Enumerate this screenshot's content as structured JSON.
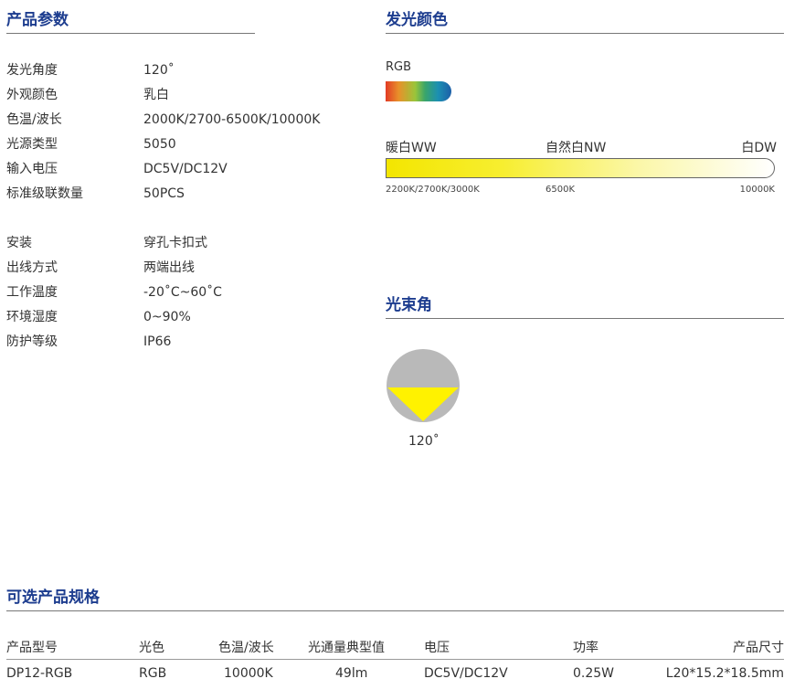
{
  "params": {
    "title": "产品参数",
    "group1": [
      {
        "k": "发光角度",
        "v": "120˚"
      },
      {
        "k": "外观颜色",
        "v": "乳白"
      },
      {
        "k": "色温/波长",
        "v": "2000K/2700-6500K/10000K"
      },
      {
        "k": "光源类型",
        "v": "5050"
      },
      {
        "k": "输入电压",
        "v": "DC5V/DC12V"
      },
      {
        "k": "标准级联数量",
        "v": "50PCS"
      }
    ],
    "group2": [
      {
        "k": "安装",
        "v": "穿孔卡扣式"
      },
      {
        "k": "出线方式",
        "v": "两端出线"
      },
      {
        "k": "工作温度",
        "v": "-20˚C~60˚C"
      },
      {
        "k": "环境湿度",
        "v": "0~90%"
      },
      {
        "k": "防护等级",
        "v": "IP66"
      }
    ]
  },
  "color": {
    "title": "发光颜色",
    "rgb_label": "RGB",
    "ww_label": "暖白WW",
    "nw_label": "自然白NW",
    "dw_label": "白DW",
    "ww_temp": "2200K/2700K/3000K",
    "nw_temp": "6500K",
    "dw_temp": "10000K"
  },
  "beam": {
    "title": "光束角",
    "angle_label": "120˚"
  },
  "specs": {
    "title": "可选产品规格",
    "headers": [
      "产品型号",
      "光色",
      "色温/波长",
      "光通量典型值",
      "电压",
      "功率",
      "产品尺寸"
    ],
    "row": [
      "DP12-RGB",
      "RGB",
      "10000K",
      "49lm",
      "DC5V/DC12V",
      "0.25W",
      "L20*15.2*18.5mm"
    ]
  },
  "colors": {
    "heading": "#1d3d8f",
    "text": "#333333",
    "beam_circle": "#b9b9b9",
    "beam_light": "#fff200"
  }
}
